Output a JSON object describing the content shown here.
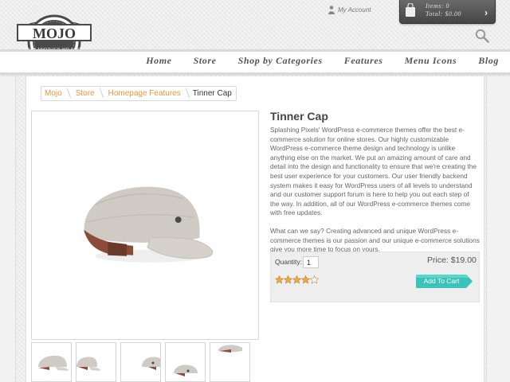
{
  "brand": {
    "name": "MOJO",
    "tagline": "JUST ANOTHER WP SHOP"
  },
  "header": {
    "account_label": "My Account",
    "cart": {
      "items_text": "Items: 0",
      "total_text": "Total: $0.00"
    }
  },
  "nav": {
    "items": [
      {
        "label": "Home"
      },
      {
        "label": "Store"
      },
      {
        "label": "Shop by Categories"
      },
      {
        "label": "Features"
      },
      {
        "label": "Menu Icons"
      },
      {
        "label": "Blog"
      }
    ]
  },
  "breadcrumb": {
    "items": [
      {
        "label": "Mojo"
      },
      {
        "label": "Store"
      },
      {
        "label": "Homepage Features"
      },
      {
        "label": "Tinner Cap"
      }
    ]
  },
  "product": {
    "title": "Tinner Cap",
    "description_1": "Splashing Pixels' WordPress e-commerce themes offer the best e-commerce solution for online stores. Our highly customizable WordPress e-commerce theme design and technology is unlike anything else on the market. We put an amazing amount of care and detail into the design and functionality to ensure that we're creating the best user experience for your customers. Our user friendly backend system makes it easy for WordPress users of all levels to understand and our customer support forum is here to help you out each step of the way. In addition, all of our WordPress e-commerce themes come with free updates.",
    "description_2": "What can we say? Creating advanced and unique WordPress e-commerce themes is our passion and our unique e-commerce solutions give you more time to focus on yours.",
    "quantity_label": "Quantity:",
    "quantity_value": "1",
    "price_text": "Price: $19.00",
    "rating": 4,
    "rating_max": 5,
    "add_to_cart_label": "Add To Cart"
  },
  "colors": {
    "accent_orange": "#e8963a",
    "cart_button": "#3cc3b9",
    "star_fill": "#f0a940"
  },
  "icons": [
    "user-icon",
    "shopping-bag-icon",
    "chevron-right-icon",
    "search-icon",
    "star-icon"
  ]
}
